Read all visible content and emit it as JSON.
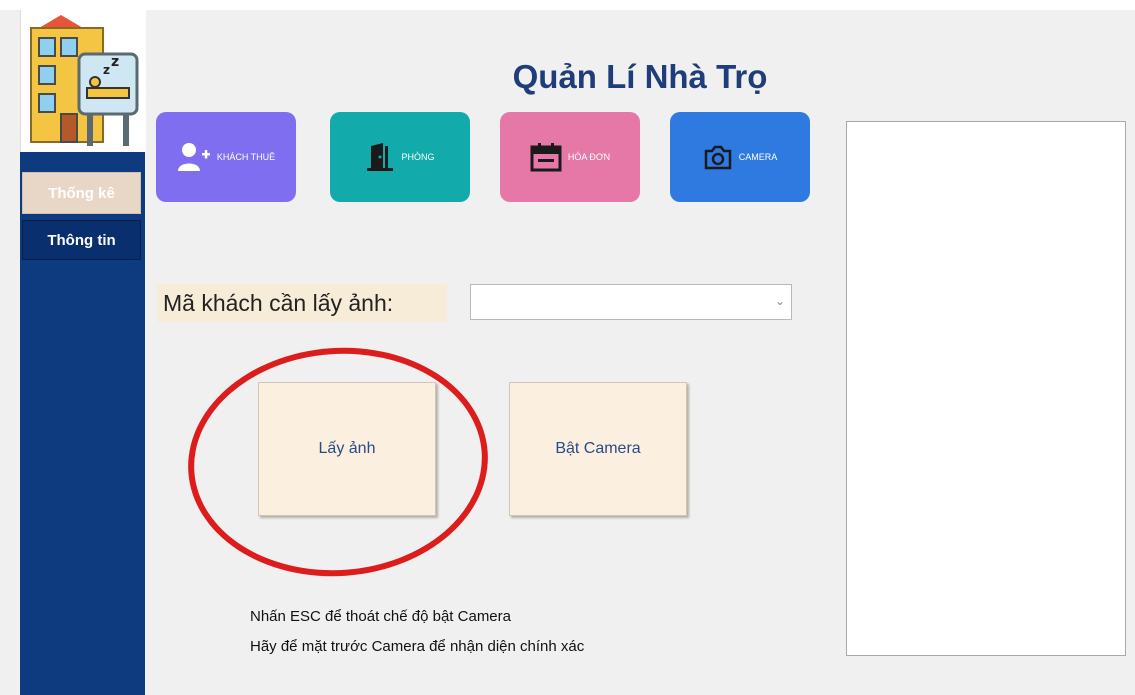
{
  "sidebar": {
    "items": [
      {
        "label": "Thống kê"
      },
      {
        "label": "Thông tin"
      }
    ]
  },
  "title": "Quản Lí Nhà Trọ",
  "tiles": [
    {
      "label": "KHÁCH THUÊ",
      "icon": "add-user-icon",
      "color": "#7f6ff0"
    },
    {
      "label": "PHÒNG",
      "icon": "door-icon",
      "color": "#12aaaa"
    },
    {
      "label": "HÓA ĐƠN",
      "icon": "calendar-icon",
      "color": "#e678a8"
    },
    {
      "label": "CAMERA",
      "icon": "camera-icon",
      "color": "#2e7ae0"
    }
  ],
  "form": {
    "customer_code_label": "Mã khách cần lấy ảnh:",
    "customer_code_value": ""
  },
  "buttons": {
    "take_photo": "Lấy ảnh",
    "turn_on_camera": "Bật Camera"
  },
  "notes": {
    "line1": "Nhấn ESC để thoát chế độ bật Camera",
    "line2": "Hãy để mặt trước Camera để nhận diện chính xác"
  },
  "annotation_color": "#dd1c1c"
}
